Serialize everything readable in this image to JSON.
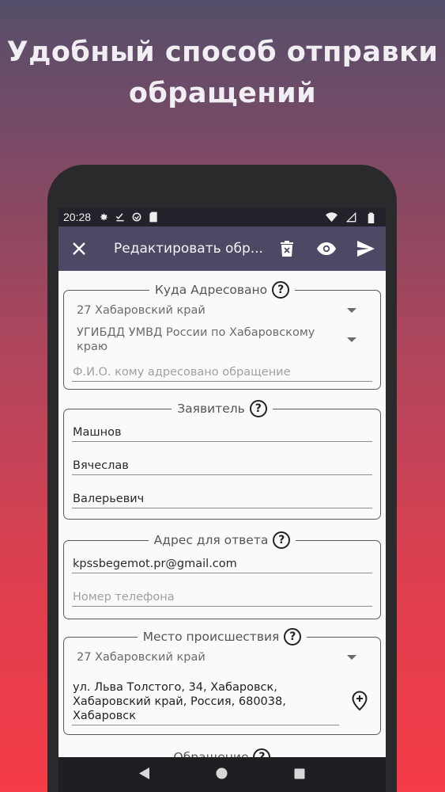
{
  "promo": {
    "line1": "Удобный способ отправки",
    "line2": "обращений"
  },
  "statusbar": {
    "time": "20:28"
  },
  "appbar": {
    "title": "Редактировать обр..."
  },
  "addressee": {
    "legend": "Куда Адресовано",
    "region": "27 Хабаровский край",
    "department": "УГИБДД УМВД России по Хабаровскому краю",
    "fio_placeholder": "Ф.И.О. кому адресовано обращение"
  },
  "applicant": {
    "legend": "Заявитель",
    "last_name": "Машнов",
    "first_name": "Вячеслав",
    "patronymic": "Валерьевич"
  },
  "reply": {
    "legend": "Адрес для ответа",
    "email": "kpssbegemot.pr@gmail.com",
    "phone_placeholder": "Номер телефона"
  },
  "incident": {
    "legend": "Место происшествия",
    "region": "27 Хабаровский край",
    "address": "ул. Льва Толстого, 34, Хабаровск, Хабаровский край, Россия, 680038, Хабаровск"
  },
  "appeal": {
    "legend": "Обращение"
  },
  "help_glyph": "?",
  "colors": {
    "appbar": "#4d4965",
    "statusbar": "#23222a",
    "navbar": "#1f1e23"
  }
}
